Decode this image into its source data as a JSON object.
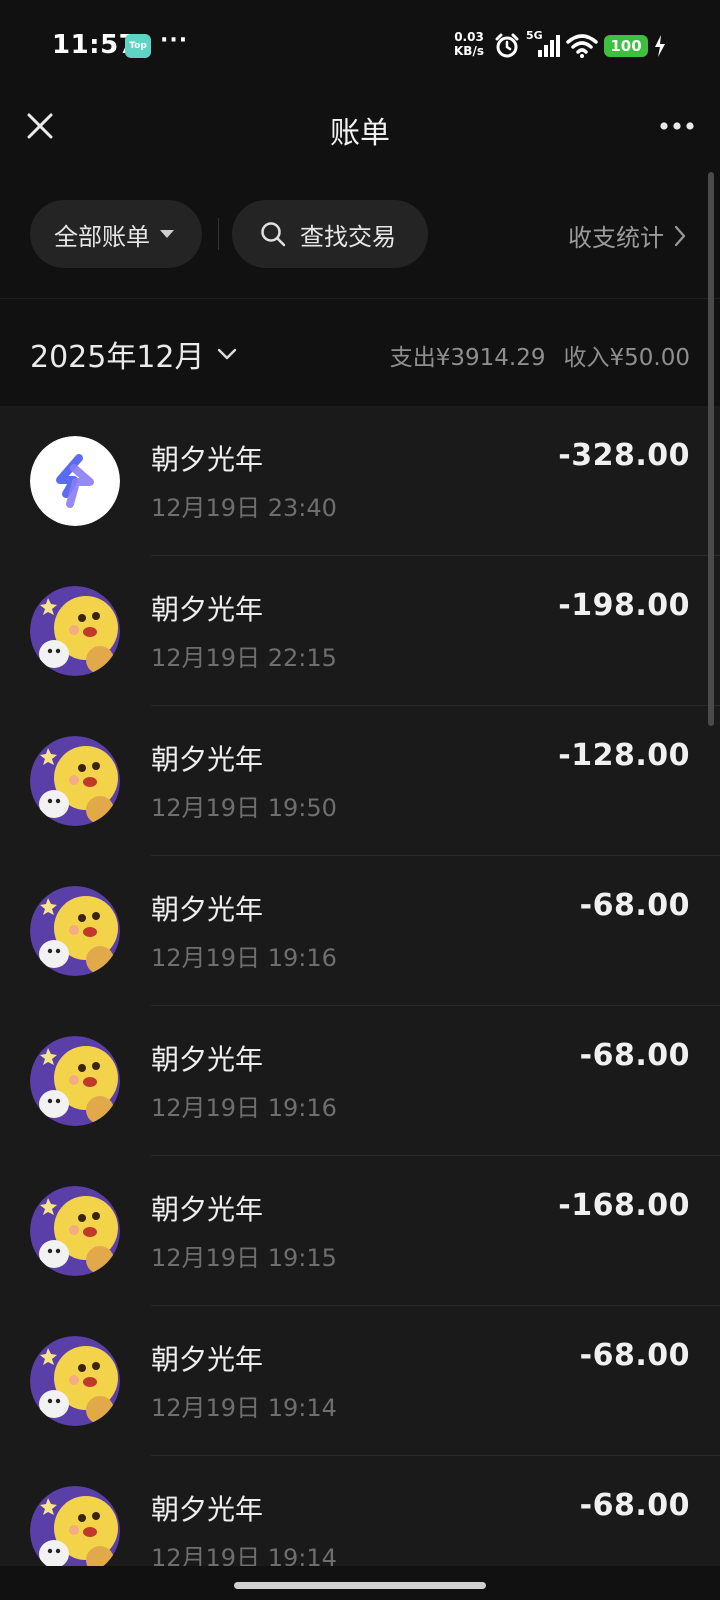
{
  "status_bar": {
    "time": "11:57",
    "top_badge": "Top",
    "dots": "···",
    "net_speed_value": "0.03",
    "net_speed_unit": "KB/s",
    "network": "5G",
    "battery": "100",
    "icons": [
      "alarm-icon",
      "signal-icon",
      "wifi-icon",
      "battery-icon",
      "charging-icon"
    ]
  },
  "header": {
    "title": "账单"
  },
  "filters": {
    "all_bills": "全部账单",
    "search": "查找交易",
    "stats": "收支统计"
  },
  "summary": {
    "month": "2025年12月",
    "expense": "支出¥3914.29",
    "income": "收入¥50.00"
  },
  "transactions": [
    {
      "merchant": "朝夕光年",
      "datetime": "12月19日 23:40",
      "amount": "-328.00",
      "avatar": "bolt-logo"
    },
    {
      "merchant": "朝夕光年",
      "datetime": "12月19日 22:15",
      "amount": "-198.00",
      "avatar": "cartoon-character"
    },
    {
      "merchant": "朝夕光年",
      "datetime": "12月19日 19:50",
      "amount": "-128.00",
      "avatar": "cartoon-character"
    },
    {
      "merchant": "朝夕光年",
      "datetime": "12月19日 19:16",
      "amount": "-68.00",
      "avatar": "cartoon-character"
    },
    {
      "merchant": "朝夕光年",
      "datetime": "12月19日 19:16",
      "amount": "-68.00",
      "avatar": "cartoon-character"
    },
    {
      "merchant": "朝夕光年",
      "datetime": "12月19日 19:15",
      "amount": "-168.00",
      "avatar": "cartoon-character"
    },
    {
      "merchant": "朝夕光年",
      "datetime": "12月19日 19:14",
      "amount": "-68.00",
      "avatar": "cartoon-character"
    },
    {
      "merchant": "朝夕光年",
      "datetime": "12月19日 19:14",
      "amount": "-68.00",
      "avatar": "cartoon-character"
    }
  ],
  "colors": {
    "background": "#111111",
    "list_background": "#1a1a1a",
    "pill_background": "#242424",
    "battery_green": "#3fbf3f",
    "top_badge": "#5fd3c4"
  }
}
